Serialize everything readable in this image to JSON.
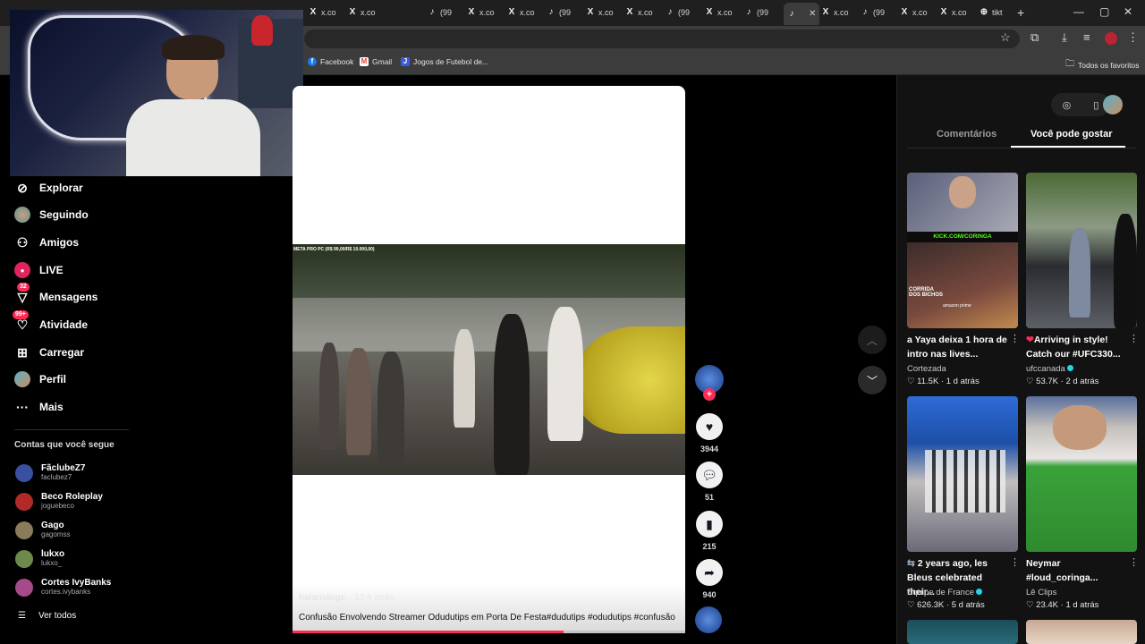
{
  "browser": {
    "tabs": [
      {
        "icon": "X",
        "label": "x.co"
      },
      {
        "icon": "X",
        "label": "x.co"
      },
      {
        "icon": "♪",
        "label": "(99"
      },
      {
        "icon": "X",
        "label": "x.co"
      },
      {
        "icon": "X",
        "label": "x.co"
      },
      {
        "icon": "♪",
        "label": "(99"
      },
      {
        "icon": "X",
        "label": "x.co"
      },
      {
        "icon": "X",
        "label": "x.co"
      },
      {
        "icon": "♪",
        "label": "(99"
      },
      {
        "icon": "X",
        "label": "x.co"
      },
      {
        "icon": "♪",
        "label": "(99"
      },
      {
        "icon": "♪",
        "label": "",
        "active": true
      },
      {
        "icon": "X",
        "label": "x.co"
      },
      {
        "icon": "♪",
        "label": "(99"
      },
      {
        "icon": "X",
        "label": "x.co"
      },
      {
        "icon": "X",
        "label": "x.co"
      },
      {
        "icon": "⊕",
        "label": "tikt"
      }
    ],
    "bookmarks": [
      {
        "label": "Facebook",
        "icon": "f",
        "color": "#1877f2"
      },
      {
        "label": "Gmail",
        "icon": "M",
        "color": "#ea4335"
      },
      {
        "label": "Jogos de Futebol de...",
        "icon": "J",
        "color": "#3b5bdb"
      }
    ],
    "all_bookmarks": "Todos os favoritos"
  },
  "nav": {
    "items": [
      {
        "label": "Explorar",
        "icon": "compass-icon"
      },
      {
        "label": "Seguindo",
        "icon": "avatar"
      },
      {
        "label": "Amigos",
        "icon": "friends-icon"
      },
      {
        "label": "LIVE",
        "icon": "live-icon"
      },
      {
        "label": "Mensagens",
        "icon": "messages-icon",
        "badge": "32"
      },
      {
        "label": "Atividade",
        "icon": "activity-icon",
        "badge": "99+"
      },
      {
        "label": "Carregar",
        "icon": "upload-icon"
      },
      {
        "label": "Perfil",
        "icon": "profile-icon"
      },
      {
        "label": "Mais",
        "icon": "more-icon"
      }
    ],
    "following_title": "Contas que você segue",
    "following": [
      {
        "name": "FãclubeZ7",
        "handle": "faclubez7",
        "color": "#3a4fa0"
      },
      {
        "name": "Beco Roleplay",
        "handle": "joguebeco",
        "color": "#b02a2a"
      },
      {
        "name": "Gago",
        "handle": "gagomss",
        "color": "#8a7b5a"
      },
      {
        "name": "lukxo",
        "handle": "lukxo_",
        "color": "#6d8a4a"
      },
      {
        "name": "Cortes IvyBanks",
        "handle": "cortes.ivybanks",
        "color": "#a64a8a"
      }
    ],
    "see_all": "Ver todos"
  },
  "video": {
    "overlay_caption": "META PRO PC (R$ 99,00/R$ 10.000,00)",
    "author": "halanviogx",
    "time": "· 13 h atrás",
    "description": "Confusão Envolvendo Streamer Odudutips em Porta De Festa#dudutips #odudutips #confusão",
    "progress": 0.69,
    "likes": "3944",
    "comments": "51",
    "saves": "215",
    "shares": "940"
  },
  "right_panel": {
    "tab_comments": "Comentários",
    "tab_suggested": "Você pode gostar",
    "cards": [
      {
        "title": "a Yaya deixa 1 hora de intro nas lives...",
        "author": "Cortezada",
        "verified": false,
        "likes": "11.5K",
        "age": "1 d atrás",
        "kick_text": "KICK.COM/CORINGA",
        "inner_text": "CORRIDA DOS BICHOS",
        "inner_sub": "amazon prime"
      },
      {
        "title": "Arriving in style! Catch our #UFC330...",
        "author": "ufccanada",
        "verified": true,
        "likes": "53.7K",
        "age": "2 d atrás"
      },
      {
        "title": "2 years ago, les Bleus celebrated their...",
        "author": "Equipe de France",
        "verified": true,
        "likes": "626.3K",
        "age": "5 d atrás"
      },
      {
        "title": "Neymar #loud_coringa...",
        "author": "Lê Clips",
        "verified": false,
        "likes": "23.4K",
        "age": "1 d atrás"
      }
    ]
  }
}
